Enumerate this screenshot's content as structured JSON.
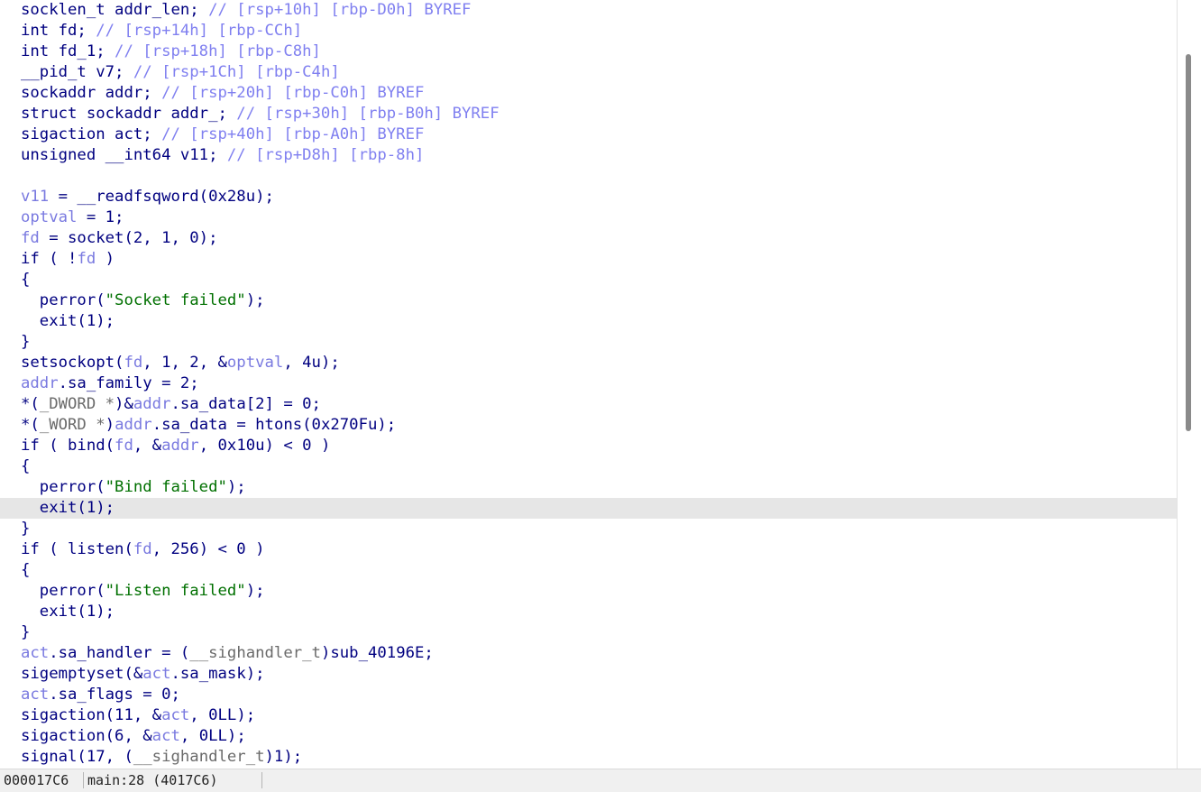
{
  "editor": {
    "highlighted_line": 24,
    "lines": [
      [
        [
          "plain",
          "socklen_t addr_len; "
        ],
        [
          "com",
          "// [rsp+10h] [rbp-D0h] BYREF"
        ]
      ],
      [
        [
          "plain",
          "int fd; "
        ],
        [
          "com",
          "// [rsp+14h] [rbp-CCh]"
        ]
      ],
      [
        [
          "plain",
          "int fd_1; "
        ],
        [
          "com",
          "// [rsp+18h] [rbp-C8h]"
        ]
      ],
      [
        [
          "plain",
          "__pid_t v7; "
        ],
        [
          "com",
          "// [rsp+1Ch] [rbp-C4h]"
        ]
      ],
      [
        [
          "plain",
          "sockaddr addr; "
        ],
        [
          "com",
          "// [rsp+20h] [rbp-C0h] BYREF"
        ]
      ],
      [
        [
          "plain",
          "struct sockaddr addr_; "
        ],
        [
          "com",
          "// [rsp+30h] [rbp-B0h] BYREF"
        ]
      ],
      [
        [
          "plain",
          "sigaction act; "
        ],
        [
          "com",
          "// [rsp+40h] [rbp-A0h] BYREF"
        ]
      ],
      [
        [
          "plain",
          "unsigned __int64 v11; "
        ],
        [
          "com",
          "// [rsp+D8h] [rbp-8h]"
        ]
      ],
      [],
      [
        [
          "var",
          "v11"
        ],
        [
          "plain",
          " = __readfsqword(0x28u);"
        ]
      ],
      [
        [
          "var",
          "optval"
        ],
        [
          "plain",
          " = 1;"
        ]
      ],
      [
        [
          "var",
          "fd"
        ],
        [
          "plain",
          " = socket(2, 1, 0);"
        ]
      ],
      [
        [
          "plain",
          "if ( !"
        ],
        [
          "var",
          "fd"
        ],
        [
          "plain",
          " )"
        ]
      ],
      [
        [
          "plain",
          "{"
        ]
      ],
      [
        [
          "plain",
          "  perror("
        ],
        [
          "str",
          "\"Socket failed\""
        ],
        [
          "plain",
          ");"
        ]
      ],
      [
        [
          "plain",
          "  exit(1);"
        ]
      ],
      [
        [
          "plain",
          "}"
        ]
      ],
      [
        [
          "plain",
          "setsockopt("
        ],
        [
          "var",
          "fd"
        ],
        [
          "plain",
          ", 1, 2, &"
        ],
        [
          "var",
          "optval"
        ],
        [
          "plain",
          ", 4u);"
        ]
      ],
      [
        [
          "var",
          "addr"
        ],
        [
          "plain",
          ".sa_family = 2;"
        ]
      ],
      [
        [
          "plain",
          "*("
        ],
        [
          "type",
          "_DWORD *"
        ],
        [
          "plain",
          ")&"
        ],
        [
          "var",
          "addr"
        ],
        [
          "plain",
          ".sa_data[2] = 0;"
        ]
      ],
      [
        [
          "plain",
          "*("
        ],
        [
          "type",
          "_WORD *"
        ],
        [
          "plain",
          ")"
        ],
        [
          "var",
          "addr"
        ],
        [
          "plain",
          ".sa_data = htons(0x270Fu);"
        ]
      ],
      [
        [
          "plain",
          "if ( bind("
        ],
        [
          "var",
          "fd"
        ],
        [
          "plain",
          ", &"
        ],
        [
          "var",
          "addr"
        ],
        [
          "plain",
          ", 0x10u) < 0 )"
        ]
      ],
      [
        [
          "plain",
          "{"
        ]
      ],
      [
        [
          "plain",
          "  perror("
        ],
        [
          "str",
          "\"Bind failed\""
        ],
        [
          "plain",
          ");"
        ]
      ],
      [
        [
          "plain",
          "  exit(1);"
        ]
      ],
      [
        [
          "plain",
          "}"
        ]
      ],
      [
        [
          "plain",
          "if ( listen("
        ],
        [
          "var",
          "fd"
        ],
        [
          "plain",
          ", 256) < 0 )"
        ]
      ],
      [
        [
          "plain",
          "{"
        ]
      ],
      [
        [
          "plain",
          "  perror("
        ],
        [
          "str",
          "\"Listen failed\""
        ],
        [
          "plain",
          ");"
        ]
      ],
      [
        [
          "plain",
          "  exit(1);"
        ]
      ],
      [
        [
          "plain",
          "}"
        ]
      ],
      [
        [
          "var",
          "act"
        ],
        [
          "plain",
          ".sa_handler = ("
        ],
        [
          "type",
          "__sighandler_t"
        ],
        [
          "plain",
          ")sub_40196E;"
        ]
      ],
      [
        [
          "plain",
          "sigemptyset(&"
        ],
        [
          "var",
          "act"
        ],
        [
          "plain",
          ".sa_mask);"
        ]
      ],
      [
        [
          "var",
          "act"
        ],
        [
          "plain",
          ".sa_flags = 0;"
        ]
      ],
      [
        [
          "plain",
          "sigaction(11, &"
        ],
        [
          "var",
          "act"
        ],
        [
          "plain",
          ", 0LL);"
        ]
      ],
      [
        [
          "plain",
          "sigaction(6, &"
        ],
        [
          "var",
          "act"
        ],
        [
          "plain",
          ", 0LL);"
        ]
      ],
      [
        [
          "plain",
          "signal(17, ("
        ],
        [
          "type",
          "__sighandler_t"
        ],
        [
          "plain",
          ")1);"
        ]
      ]
    ]
  },
  "status_bar": {
    "address": "000017C6",
    "location": "main:28 (4017C6)"
  }
}
